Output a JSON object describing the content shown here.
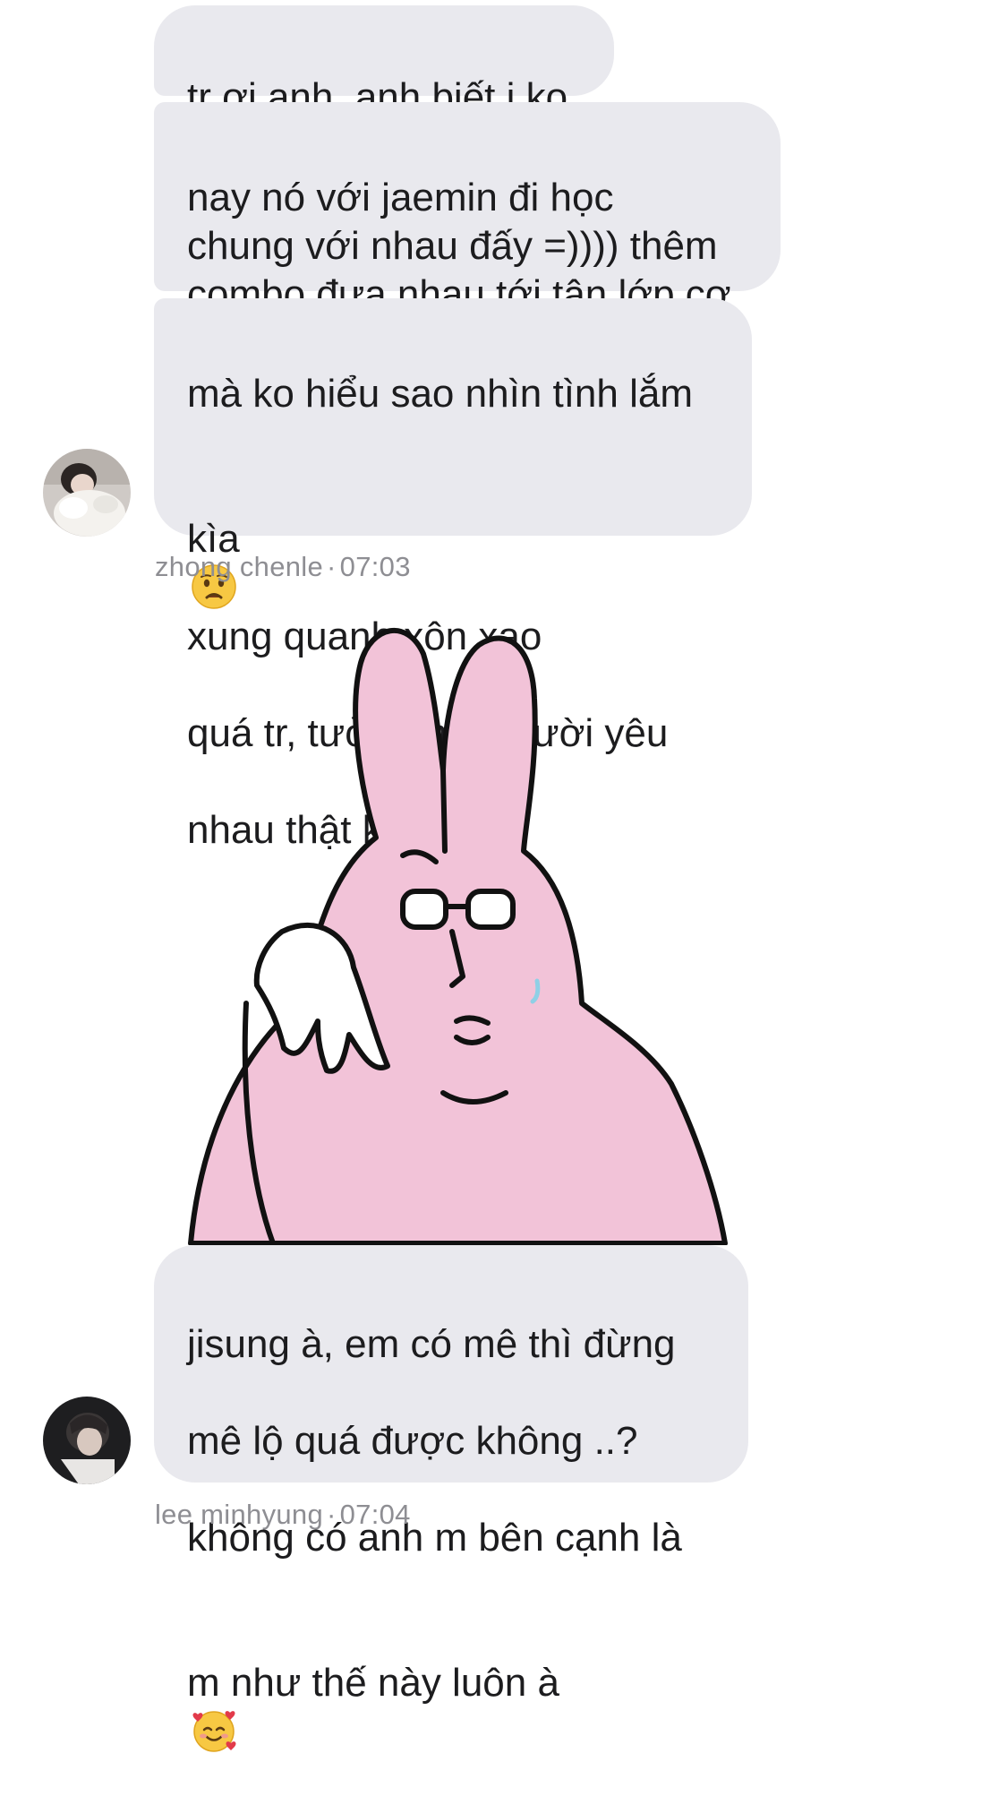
{
  "conversation": {
    "group1": {
      "messages": [
        "tr ơi anh, anh biết j ko",
        "nay nó với jaemin đi học\nchung với nhau đấy =)))) thêm\ncombo đưa nhau tới tận lớp cơ"
      ],
      "last_message": {
        "line1": "mà ko hiểu sao nhìn tình lắm",
        "line2_before": "kìa",
        "line2_after": "xung quanh xôn xao",
        "line3": "quá tr, tưởng hai người yêu",
        "line4": "nhau thật ko đó !?",
        "emoji": "worried-face"
      },
      "sender": "zhong chenle",
      "time": "07:03"
    },
    "sticker": {
      "description_icon": "pink-rabbit-sticker"
    },
    "group2": {
      "message": {
        "line1": "jisung à, em có mê thì đừng",
        "line2": "mê lộ quá được không ..?",
        "line3": "không có anh m bên cạnh là",
        "line4_before": "m như thế này luôn à",
        "emoji": "smiling-face-with-hearts"
      },
      "sender": "lee minhyung",
      "time": "07:04"
    }
  },
  "colors": {
    "bubble": "#e9e9ee",
    "meta_text": "#8e8e93",
    "sticker_pink": "#f2c3d8"
  }
}
